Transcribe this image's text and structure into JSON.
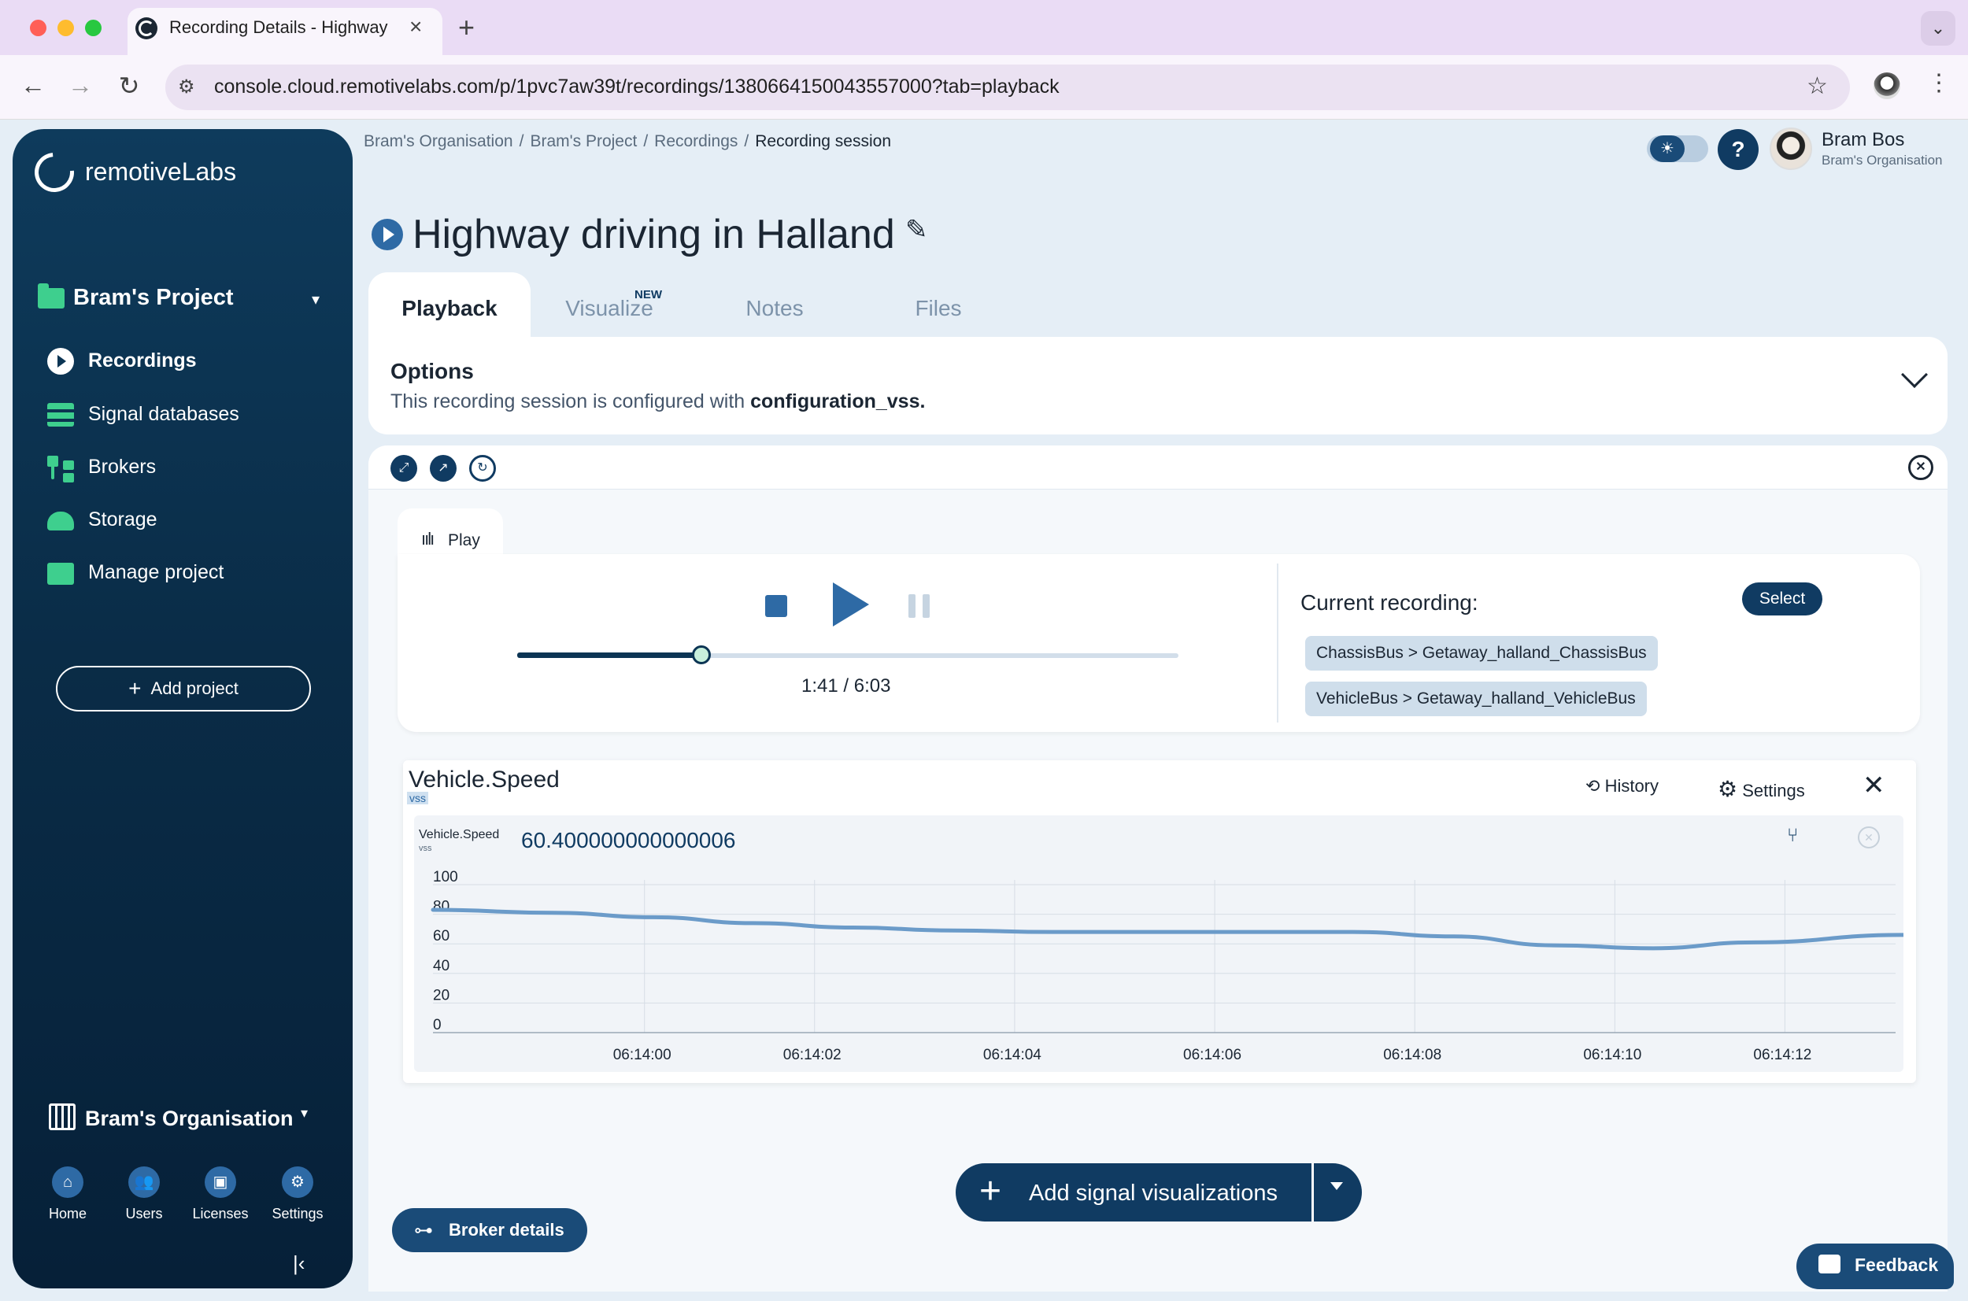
{
  "browser": {
    "tab_title": "Recording Details - Highway",
    "url": "console.cloud.remotivelabs.com/p/1pvc7aw39t/recordings/1380664150043557000?tab=playback"
  },
  "sidebar": {
    "brand": "remotiveLabs",
    "project": "Bram's Project",
    "items": [
      {
        "label": "Recordings",
        "icon": "play-circle-icon"
      },
      {
        "label": "Signal databases",
        "icon": "database-icon"
      },
      {
        "label": "Brokers",
        "icon": "hierarchy-icon"
      },
      {
        "label": "Storage",
        "icon": "cloud-upload-icon"
      },
      {
        "label": "Manage project",
        "icon": "folder-user-icon"
      }
    ],
    "add_project": "Add project",
    "organisation": "Bram's Organisation",
    "bottom_nav": [
      {
        "label": "Home",
        "icon": "home-icon"
      },
      {
        "label": "Users",
        "icon": "users-icon"
      },
      {
        "label": "Licenses",
        "icon": "license-icon"
      },
      {
        "label": "Settings",
        "icon": "gear-icon"
      }
    ]
  },
  "header": {
    "breadcrumb": [
      "Bram's Organisation",
      "Bram's Project",
      "Recordings",
      "Recording session"
    ],
    "user_name": "Bram Bos",
    "user_org": "Bram's Organisation"
  },
  "page": {
    "title": "Highway driving in Halland",
    "tabs": [
      {
        "label": "Playback",
        "active": true
      },
      {
        "label": "Visualize",
        "badge": "NEW"
      },
      {
        "label": "Notes"
      },
      {
        "label": "Files"
      }
    ]
  },
  "options": {
    "title": "Options",
    "description_prefix": "This recording session is configured with ",
    "config_name": "configuration_vss."
  },
  "player": {
    "tab_label": "Play",
    "time": "1:41 / 6:03",
    "progress_fraction": 0.278,
    "current_recording_label": "Current recording:",
    "select_label": "Select",
    "recordings": [
      "ChassisBus > Getaway_halland_ChassisBus",
      "VehicleBus > Getaway_halland_VehicleBus"
    ]
  },
  "signal_panel": {
    "title": "Vehicle.Speed",
    "tag": "vss",
    "history_label": "History",
    "settings_label": "Settings",
    "series_name": "Vehicle.Speed",
    "series_tag": "vss",
    "current_value": "60.400000000000006"
  },
  "chart_data": {
    "type": "line",
    "y_ticks": [
      "100",
      "80",
      "60",
      "40",
      "20",
      "0"
    ],
    "ylim": [
      0,
      100
    ],
    "x_ticks": [
      "06:14:00",
      "06:14:02",
      "06:14:04",
      "06:14:06",
      "06:14:08",
      "06:14:10",
      "06:14:12"
    ],
    "x_tick_seconds": [
      -0.4,
      1.3,
      3.3,
      5.3,
      7.3,
      9.3,
      11.0
    ],
    "x_range_seconds": [
      -2.2,
      12.5
    ],
    "series": [
      {
        "x_seconds": [
          -2.2,
          -1.0,
          0.0,
          1.0,
          2.0,
          3.0,
          4.0,
          5.0,
          6.0,
          7.0,
          8.0,
          9.0,
          10.0,
          11.0,
          12.5
        ],
        "values": [
          83,
          81,
          78,
          74,
          71,
          69,
          68,
          68,
          68,
          68,
          65,
          59,
          57,
          61,
          66
        ],
        "color": "#6b9bc9"
      }
    ]
  },
  "actions": {
    "add_signal": "Add signal visualizations",
    "broker_details": "Broker details",
    "feedback": "Feedback"
  },
  "colors": {
    "navy": "#103b62",
    "accent": "#2e6aa5",
    "green": "#3ecf8e",
    "page_bg": "#e5eef6"
  }
}
